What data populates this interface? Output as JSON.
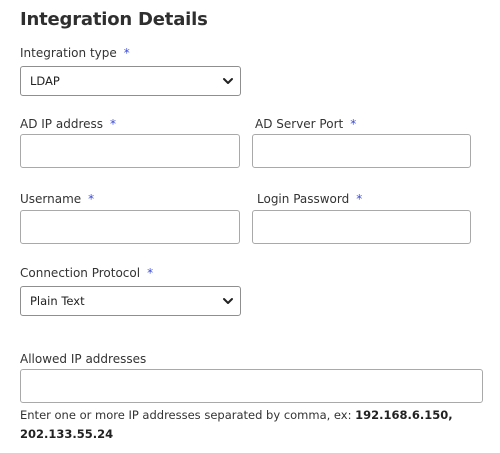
{
  "section": {
    "title": "Integration Details"
  },
  "required_marker": "*",
  "fields": {
    "integration_type": {
      "label": "Integration type",
      "value": "LDAP"
    },
    "ad_ip_address": {
      "label": "AD IP address",
      "value": ""
    },
    "ad_server_port": {
      "label": "AD Server Port",
      "value": ""
    },
    "username": {
      "label": "Username",
      "value": ""
    },
    "login_password": {
      "label": "Login Password",
      "value": ""
    },
    "connection_protocol": {
      "label": "Connection Protocol",
      "value": "Plain Text"
    },
    "allowed_ip_addresses": {
      "label": "Allowed IP addresses",
      "value": ""
    }
  },
  "help": {
    "text": "Enter one or more IP addresses separated by comma, ex: ",
    "example": "192.168.6.150, 202.133.55.24"
  },
  "colors": {
    "required": "#3b4bd8",
    "border": "#a9a9a9"
  },
  "icons": {
    "dropdown": "chevron-down-icon"
  }
}
